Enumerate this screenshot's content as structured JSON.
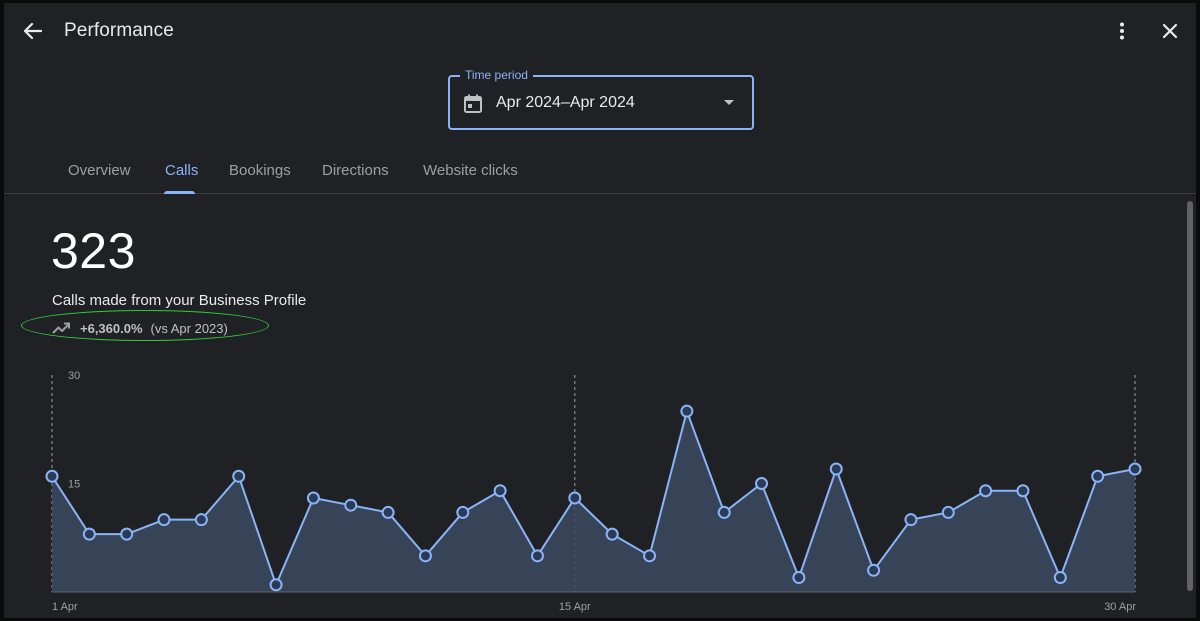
{
  "header": {
    "title": "Performance",
    "back_icon": "arrow-back-icon",
    "more_icon": "more-vert-icon",
    "close_icon": "close-icon"
  },
  "time_period": {
    "label": "Time period",
    "value": "Apr 2024–Apr 2024",
    "icon": "calendar-icon"
  },
  "tabs": [
    {
      "label": "Overview",
      "active": false
    },
    {
      "label": "Calls",
      "active": true
    },
    {
      "label": "Bookings",
      "active": false
    },
    {
      "label": "Directions",
      "active": false
    },
    {
      "label": "Website clicks",
      "active": false
    }
  ],
  "metric": {
    "value": "323",
    "description": "Calls made from your Business Profile",
    "change": "+6,360.0%",
    "comparison": "(vs Apr 2023)",
    "trend_icon": "trending-up-icon"
  },
  "colors": {
    "accent": "#8ab4f8",
    "background": "#202124",
    "highlight": "#2ecc40"
  },
  "chart_data": {
    "type": "area",
    "x": [
      1,
      2,
      3,
      4,
      5,
      6,
      7,
      8,
      9,
      10,
      11,
      12,
      13,
      14,
      15,
      16,
      17,
      18,
      19,
      20,
      21,
      22,
      23,
      24,
      25,
      26,
      27,
      28,
      29,
      30
    ],
    "values": [
      16,
      8,
      8,
      10,
      10,
      16,
      1,
      13,
      12,
      11,
      5,
      11,
      14,
      5,
      13,
      8,
      5,
      25,
      11,
      15,
      2,
      17,
      3,
      10,
      11,
      14,
      14,
      2,
      16,
      17
    ],
    "x_tick_labels": [
      {
        "x": 1,
        "label": "1 Apr"
      },
      {
        "x": 15,
        "label": "15 Apr"
      },
      {
        "x": 30,
        "label": "30 Apr"
      }
    ],
    "y_tick_labels": [
      {
        "y": 30,
        "label": "30"
      },
      {
        "y": 15,
        "label": "15"
      }
    ],
    "ylim": [
      0,
      30
    ],
    "grid": "vertical dashed at labeled dates",
    "line_color": "#8ab4f8",
    "fill_color": "#3c4a60"
  }
}
